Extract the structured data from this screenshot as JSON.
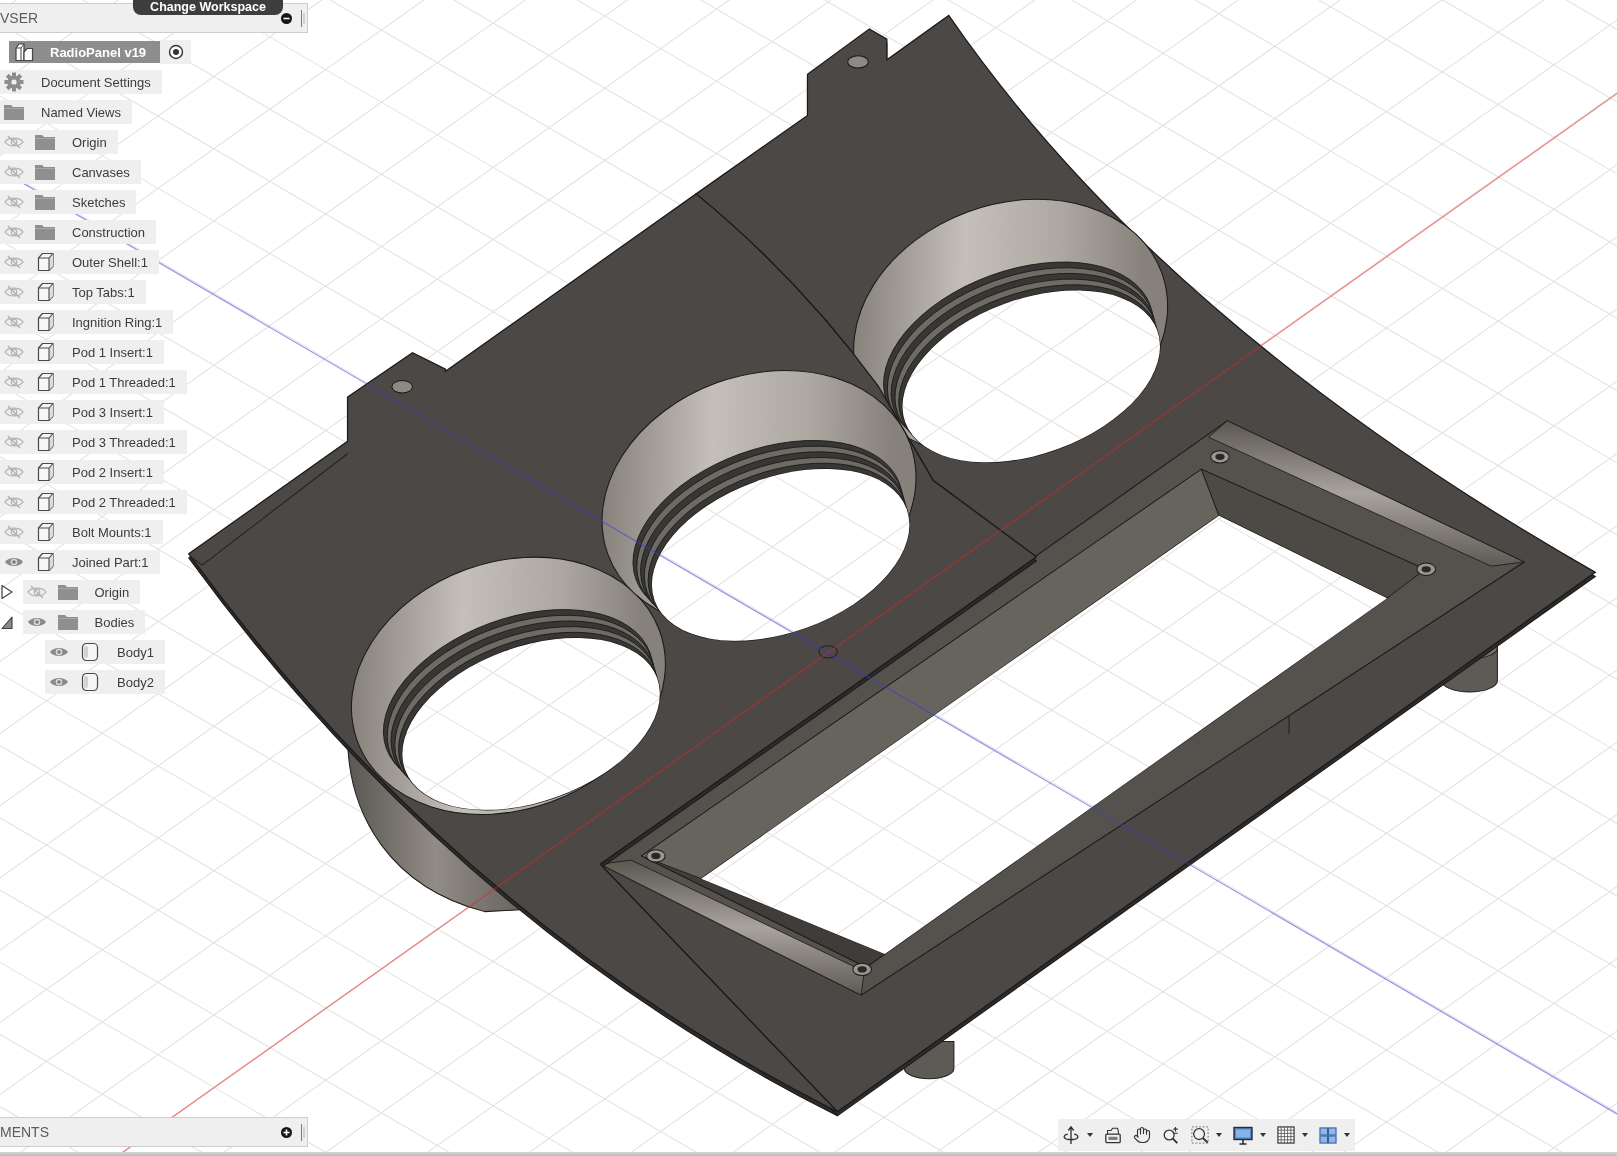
{
  "tooltip": {
    "text": "Change Workspace"
  },
  "browser": {
    "title": "VSER",
    "expanded": true,
    "document": {
      "name": "RadioPanel v19",
      "active": true
    },
    "items": [
      {
        "label": "Document Settings",
        "kind": "settings"
      },
      {
        "label": "Named Views",
        "kind": "folder"
      },
      {
        "label": "Origin",
        "kind": "folder",
        "visible": false
      },
      {
        "label": "Canvases",
        "kind": "folder",
        "visible": false
      },
      {
        "label": "Sketches",
        "kind": "folder",
        "visible": false
      },
      {
        "label": "Construction",
        "kind": "folder",
        "visible": false
      },
      {
        "label": "Outer Shell:1",
        "kind": "component",
        "visible": false
      },
      {
        "label": "Top Tabs:1",
        "kind": "component",
        "visible": false
      },
      {
        "label": "Ingnition Ring:1",
        "kind": "component",
        "visible": false
      },
      {
        "label": "Pod 1 Insert:1",
        "kind": "component",
        "visible": false
      },
      {
        "label": "Pod 1 Threaded:1",
        "kind": "component",
        "visible": false
      },
      {
        "label": "Pod 3 Insert:1",
        "kind": "component",
        "visible": false
      },
      {
        "label": "Pod 3 Threaded:1",
        "kind": "component",
        "visible": false
      },
      {
        "label": "Pod 2 Insert:1",
        "kind": "component",
        "visible": false
      },
      {
        "label": "Pod 2 Threaded:1",
        "kind": "component",
        "visible": false
      },
      {
        "label": "Bolt Mounts:1",
        "kind": "component",
        "visible": false
      },
      {
        "label": "Joined Part:1",
        "kind": "component",
        "visible": true,
        "children": [
          {
            "label": "Origin",
            "kind": "folder",
            "visible": false,
            "expanded": false
          },
          {
            "label": "Bodies",
            "kind": "folder",
            "visible": true,
            "expanded": true,
            "children": [
              {
                "label": "Body1",
                "kind": "body",
                "visible": true
              },
              {
                "label": "Body2",
                "kind": "body",
                "visible": true
              }
            ]
          }
        ]
      }
    ]
  },
  "comments": {
    "title": "MENTS",
    "expanded": false
  }
}
